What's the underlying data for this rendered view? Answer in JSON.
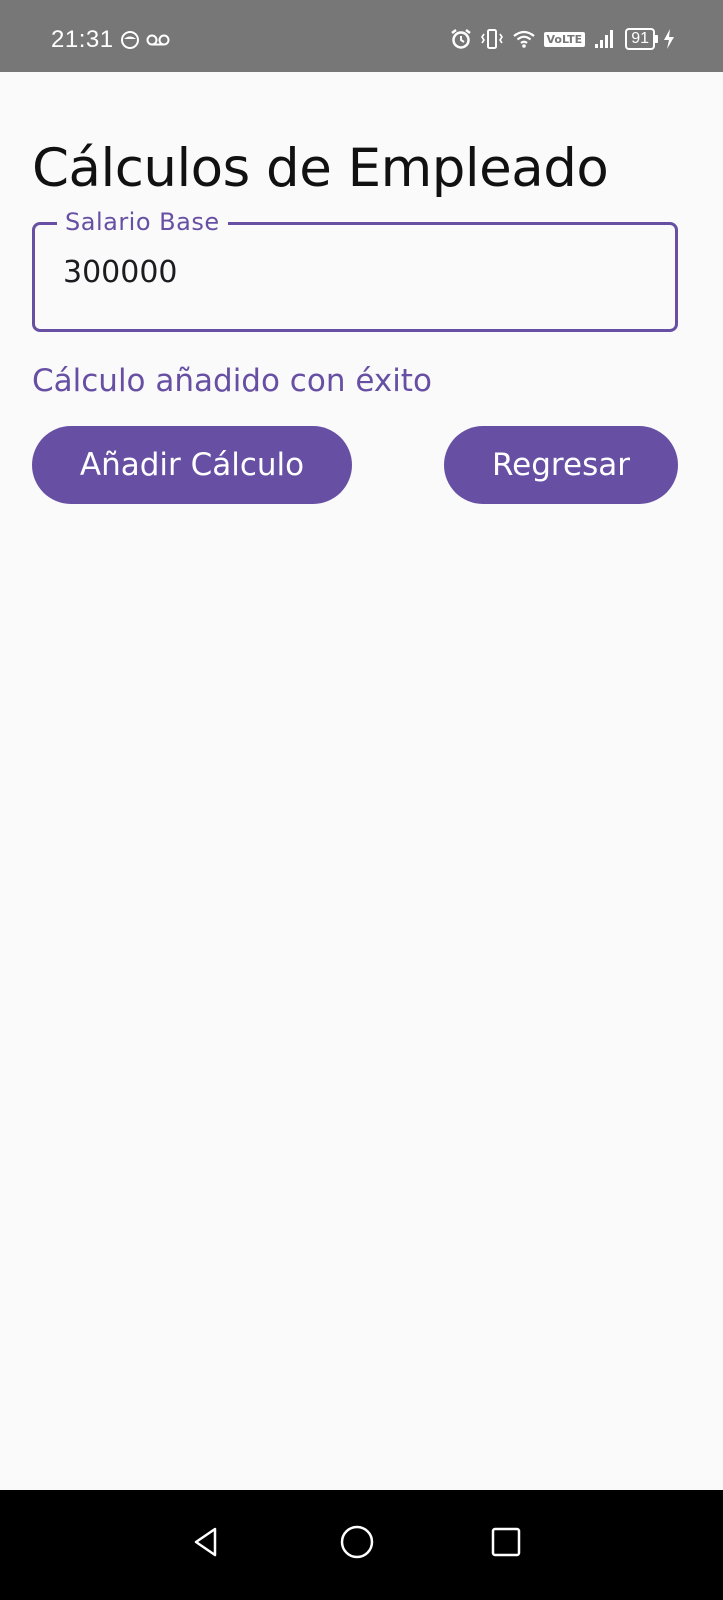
{
  "status_bar": {
    "time": "21:31",
    "battery": "91",
    "network_badge": "VoLTE",
    "icons": [
      "face-icon",
      "voicemail-icon",
      "alarm-icon",
      "vibrate-icon",
      "wifi-icon",
      "volte-icon",
      "signal-icon",
      "battery-icon",
      "charging-icon"
    ]
  },
  "screen": {
    "title": "Cálculos de Empleado",
    "salary_field": {
      "label": "Salario Base",
      "value": "300000"
    },
    "status_message": "Cálculo añadido con éxito",
    "buttons": {
      "add": "Añadir Cálculo",
      "back": "Regresar"
    }
  },
  "navigation": {
    "icons": [
      "back-icon",
      "home-icon",
      "recents-icon"
    ]
  },
  "colors": {
    "accent": "#6750a4",
    "background": "#fafafa",
    "status_bar": "#777777",
    "nav_bar": "#000000"
  }
}
